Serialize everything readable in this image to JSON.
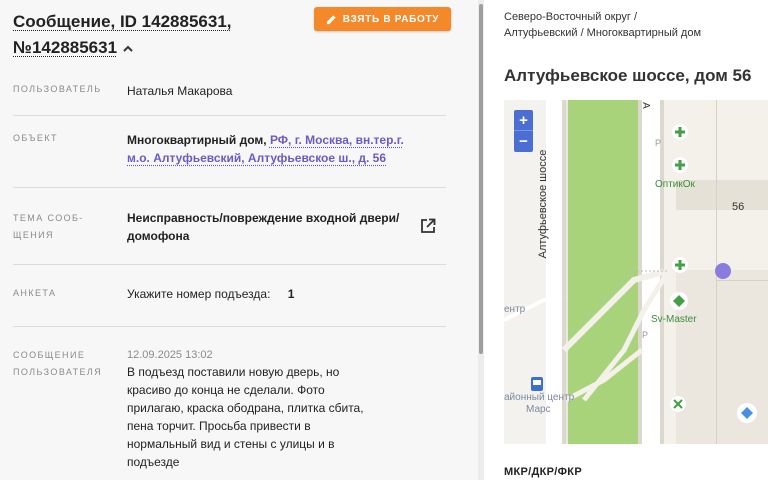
{
  "header": {
    "title_line1": "Сообщение, ID 142885631,",
    "title_line2": "№142885631",
    "take_button": "ВЗЯТЬ В РАБОТУ"
  },
  "fields": {
    "user": {
      "label": "ПОЛЬЗОВАТЕЛЬ",
      "value": "Наталья Макарова"
    },
    "object": {
      "label": "ОБЪЕКТ",
      "prefix": "Многоквартирный дом,",
      "link": "РФ, г. Москва, вн.тер.г. м.о. Алтуфьевский, Алтуфьевское ш., д. 56"
    },
    "topic": {
      "label_line1": "ТЕМА СООБ-",
      "label_line2": "ЩЕНИЯ",
      "value_line1": "Неисправность/повреждение входной двери/",
      "value_line2": "домофона"
    },
    "survey": {
      "label": "АНКЕТА",
      "question": "Укажите номер подъезда:",
      "answer": "1"
    },
    "message": {
      "label_line1": "СООБЩЕНИЕ",
      "label_line2": "ПОЛЬЗОВАТЕЛЯ",
      "date": "12.09.2025 13:02",
      "text": "В подъезд поставили новую дверь, но красиво до конца не сделали. Фото прилагаю, краска ободрана, плитка сбита, пена торчит. Просьба привести в нормальный вид и стены с улицы и в подъезде"
    }
  },
  "right_panel": {
    "breadcrumb_line1": "Северо-Восточный округ /",
    "breadcrumb_line2": "Алтуфьевский / Многоквартирный дом",
    "address": "Алтуфьевское шоссе, дом 56",
    "section_title": "МКР/ДКР/ФКР"
  },
  "map": {
    "street_label": "Алтуфьевское шоссе",
    "street_label_short": "А",
    "poi_optik": "ОптикОк",
    "poi_svmaster": "Sv-Master",
    "house_number": "56",
    "label_centr": "ентр",
    "label_mall_line1": "айонный центр",
    "label_mall_line2": "Марс",
    "label_p": "P",
    "zoom_in": "+",
    "zoom_out": "−",
    "colors": {
      "green_strip": "#a9d37b",
      "marker": "#8a7be0",
      "poi_green": "#43a047",
      "zoom": "#4a6ed1"
    }
  },
  "accent": "#f5892a",
  "link_color": "#6a5bc7"
}
